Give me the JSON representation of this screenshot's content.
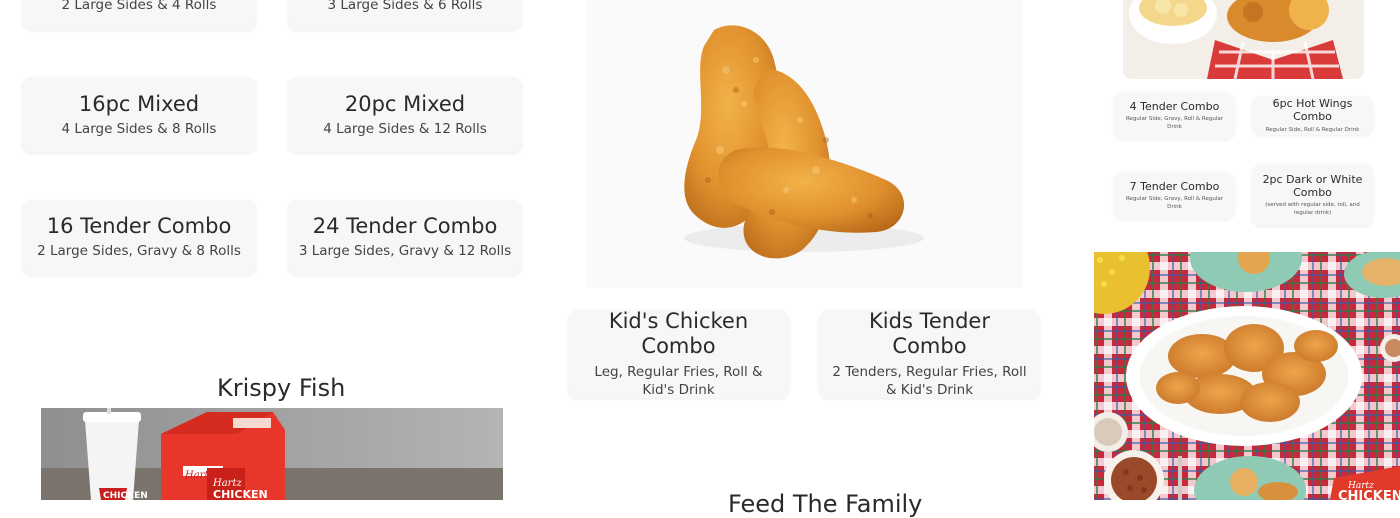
{
  "left_combos": [
    {
      "title": "",
      "subtitle": "2 Large Sides & 4 Rolls"
    },
    {
      "title": "",
      "subtitle": "3 Large Sides & 6 Rolls"
    },
    {
      "title": "16pc Mixed",
      "subtitle": "4 Large Sides & 8 Rolls"
    },
    {
      "title": "20pc Mixed",
      "subtitle": "4 Large Sides & 12 Rolls"
    },
    {
      "title": "16 Tender Combo",
      "subtitle": "2 Large Sides, Gravy & 8 Rolls"
    },
    {
      "title": "24 Tender Combo",
      "subtitle": "3 Large Sides, Gravy & 12 Rolls"
    }
  ],
  "kids_combos": [
    {
      "title": "Kid's Chicken Combo",
      "subtitle": "Leg, Regular Fries, Roll & Kid's Drink"
    },
    {
      "title": "Kids Tender Combo",
      "subtitle": "2 Tenders, Regular Fries, Roll & Kid's Drink"
    }
  ],
  "right_combos": [
    {
      "title": "4 Tender Combo",
      "subtitle": "Regular Side, Gravy, Roll & Regular Drink"
    },
    {
      "title": "6pc Hot Wings Combo",
      "subtitle": "Regular Side, Roll & Regular Drink"
    },
    {
      "title": "7 Tender Combo",
      "subtitle": "Regular Side, Gravy, Roll & Regular Drink"
    },
    {
      "title": "2pc Dark or White Combo",
      "subtitle": "(served with regular side, roll, and regular drink)"
    }
  ],
  "sections": {
    "fish_heading": "Krispy Fish",
    "family_heading": "Feed The Family"
  },
  "brand": {
    "logo_top": "Hartz",
    "logo_bottom": "CHICKEN"
  }
}
